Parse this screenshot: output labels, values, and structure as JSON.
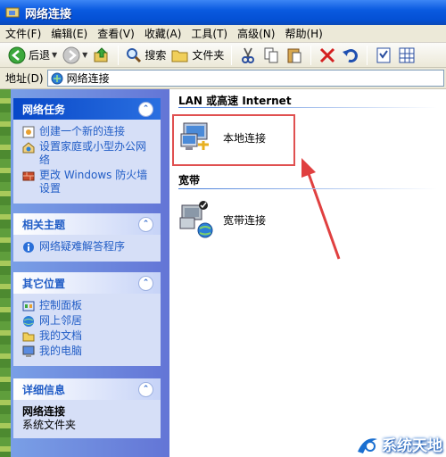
{
  "window": {
    "title": "网络连接"
  },
  "menu": [
    "文件(F)",
    "编辑(E)",
    "查看(V)",
    "收藏(A)",
    "工具(T)",
    "高级(N)",
    "帮助(H)"
  ],
  "toolbar": {
    "back_label": "后退",
    "search_label": "搜索",
    "folders_label": "文件夹"
  },
  "address": {
    "label": "地址(D)",
    "value": "网络连接"
  },
  "sidebar": {
    "network_tasks": {
      "title": "网络任务",
      "items": [
        "创建一个新的连接",
        "设置家庭或小型办公网络",
        "更改 Windows 防火墙设置"
      ]
    },
    "related": {
      "title": "相关主题",
      "items": [
        "网络疑难解答程序"
      ]
    },
    "other_places": {
      "title": "其它位置",
      "items": [
        "控制面板",
        "网上邻居",
        "我的文档",
        "我的电脑"
      ]
    },
    "details": {
      "title": "详细信息",
      "name": "网络连接",
      "type": "系统文件夹"
    }
  },
  "main": {
    "groups": [
      {
        "header": "LAN 或高速 Internet",
        "items": [
          "本地连接"
        ]
      },
      {
        "header": "宽带",
        "items": [
          "宽带连接"
        ]
      }
    ]
  },
  "watermark": "系统天地",
  "colors": {
    "titlebar": "#0a5ae0",
    "link": "#215dc6",
    "highlight": "#e05050"
  }
}
